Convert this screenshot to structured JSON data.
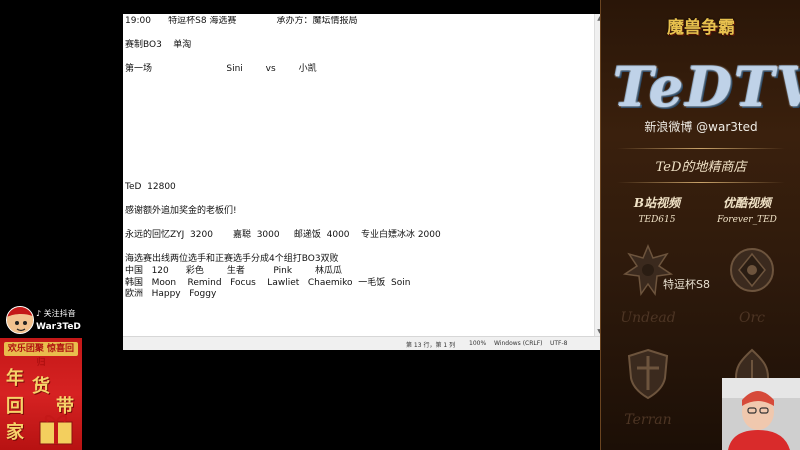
{
  "editor": {
    "lines": [
      "19:00      特逗杯S8 海选赛              承办方：魔坛情报局",
      "",
      "赛制BO3    单淘",
      "",
      "第一场                          Sini        vs        小凯",
      "",
      "",
      "",
      "",
      "",
      "",
      "",
      "",
      "",
      "TeD  12800",
      "",
      "感谢额外追加奖金的老板们!",
      "",
      "永远的回忆ZYJ  3200       嘉聪  3000     邮递饭  4000    专业白嫖冰冰 2000",
      "",
      "海选赛出线两位选手和正赛选手分成4个组打BO3双败",
      "中国   120      彩色        生者          Pink        林瓜瓜",
      "韩国   Moon    Remind   Focus    Lawliet   Chaemiko  一毛饭  Soin",
      "欧洲   Happy   Foggy"
    ],
    "status": {
      "position": "第 13 行，第 1 列",
      "zoom": "100%",
      "line_ending": "Windows (CRLF)",
      "encoding": "UTF-8"
    }
  },
  "overlay": {
    "game_logo": "魔兽争霸",
    "channel_logo": "TeDTV",
    "weibo": "新浪微博 @war3ted",
    "shop": "TeD的地精商店",
    "platforms": [
      {
        "name": "B站视频",
        "id": "TED615"
      },
      {
        "name": "优酷视频",
        "id": "Forever_TED"
      }
    ],
    "cup_label": "特逗杯S8",
    "races": [
      "Undead",
      "Orc",
      "Terran",
      "NE"
    ]
  },
  "douyin": {
    "follow": "关注抖音",
    "name": "War3TeD"
  },
  "promo": {
    "banner": "欢乐团聚 惊喜回归",
    "chars": [
      "年",
      "货",
      "回",
      "带",
      "家"
    ]
  },
  "colors": {
    "panel_brown": "#2e1a0c",
    "gold": "#e8c14e",
    "promo_red": "#d62222"
  }
}
